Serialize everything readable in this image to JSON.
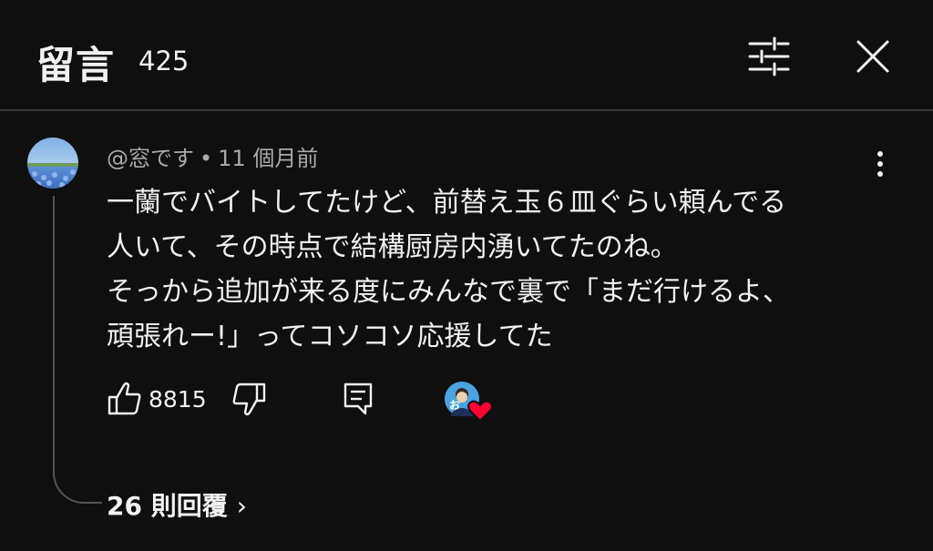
{
  "header": {
    "title": "留言",
    "comment_count": "425",
    "filter_icon": "sliders-icon",
    "close_icon": "close-icon"
  },
  "comment": {
    "author": "@窓です",
    "separator": "•",
    "timestamp": "11 個月前",
    "lines": [
      "一蘭でバイトしてたけど、前替え玉６皿ぐらい頼んでる",
      "人いて、その時点で結構厨房内湧いてたのね。",
      "そっから追加が来る度にみんなで裏で「まだ行けるよ、",
      "頑張れー!」ってコソコソ応援してた"
    ],
    "like_count": "8815",
    "creator_avatar_text": "お",
    "replies_label": "26 則回覆",
    "replies_chevron": "›"
  },
  "colors": {
    "background": "#0f0f0f",
    "text": "#f1f1f1",
    "secondary_text": "#aaaaaa",
    "heart": "#ff0033"
  }
}
